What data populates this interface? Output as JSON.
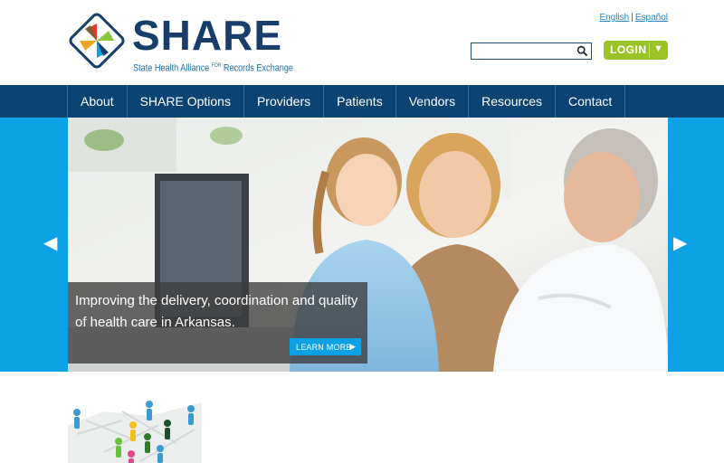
{
  "brand": {
    "name": "SHARE",
    "tagline_pre": "State Health Alliance",
    "tagline_for": "FOR",
    "tagline_post": "Records Exchange"
  },
  "language": {
    "english": "English",
    "separator": "|",
    "spanish": "Español"
  },
  "search": {
    "placeholder": "",
    "value": "",
    "icon": "search-icon"
  },
  "login": {
    "label": "LOGIN",
    "arrow": "▼"
  },
  "nav": {
    "items": [
      {
        "label": "About"
      },
      {
        "label": "SHARE Options"
      },
      {
        "label": "Providers"
      },
      {
        "label": "Patients"
      },
      {
        "label": "Vendors"
      },
      {
        "label": "Resources"
      },
      {
        "label": "Contact"
      }
    ]
  },
  "hero": {
    "prev_arrow": "◀",
    "next_arrow": "▶",
    "caption": "Improving the delivery, coordination and quality of health care in Arkansas.",
    "cta_label": "LEARN MORE",
    "cta_arrow": "▶"
  },
  "colors": {
    "nav_bg": "#0b4472",
    "accent_blue": "#0ca0e4",
    "login_green": "#9ac328",
    "brand_navy": "#173e6b"
  }
}
